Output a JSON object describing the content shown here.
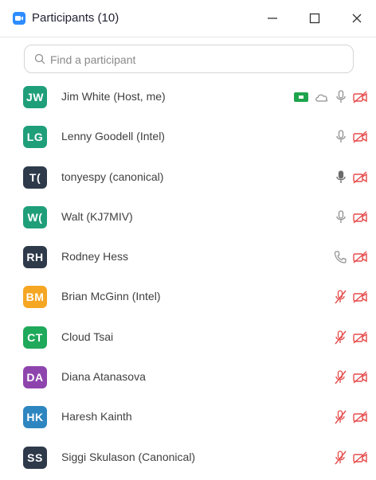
{
  "window": {
    "title": "Participants (10)",
    "minimize_symbol": "—",
    "maximize_symbol": "□",
    "close_symbol": "✕"
  },
  "search": {
    "placeholder": "Find a participant",
    "value": ""
  },
  "colors": {
    "muted_red": "#e64b4b",
    "green": "#1ea44c",
    "icon_gray": "#8f8f8f"
  },
  "participants": [
    {
      "initials": "JW",
      "name": "Jim White (Host, me)",
      "avatar_color": "#1f9e7a",
      "audio": "mic-on",
      "video": "video-off",
      "extra": [
        "screen-share-green",
        "cloud-icon"
      ]
    },
    {
      "initials": "LG",
      "name": "Lenny Goodell (Intel)",
      "avatar_color": "#1f9e7a",
      "audio": "mic-on",
      "video": "video-off"
    },
    {
      "initials": "T(",
      "name": "tonyespy (canonical)",
      "avatar_color": "#2e3a4a",
      "audio": "mic-speaking",
      "video": "video-off"
    },
    {
      "initials": "W(",
      "name": "Walt (KJ7MIV)",
      "avatar_color": "#1f9e7a",
      "audio": "mic-on",
      "video": "video-off"
    },
    {
      "initials": "RH",
      "name": "Rodney Hess",
      "avatar_color": "#2e3a4a",
      "audio": "phone",
      "video": "video-off"
    },
    {
      "initials": "BM",
      "name": "Brian McGinn (Intel)",
      "avatar_color": "#f5a623",
      "audio": "mic-muted",
      "video": "video-off"
    },
    {
      "initials": "CT",
      "name": "Cloud Tsai",
      "avatar_color": "#1fa95a",
      "audio": "mic-muted",
      "video": "video-off"
    },
    {
      "initials": "DA",
      "name": "Diana Atanasova",
      "avatar_color": "#8e44ad",
      "audio": "mic-muted",
      "video": "video-off"
    },
    {
      "initials": "HK",
      "name": "Haresh Kainth",
      "avatar_color": "#2e86c1",
      "audio": "mic-muted",
      "video": "video-off"
    },
    {
      "initials": "SS",
      "name": "Siggi Skulason (Canonical)",
      "avatar_color": "#2e3a4a",
      "audio": "mic-muted",
      "video": "video-off"
    }
  ]
}
